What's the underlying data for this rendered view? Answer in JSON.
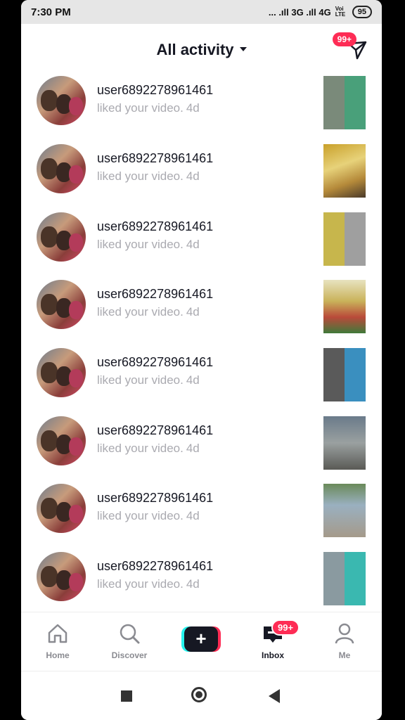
{
  "status": {
    "time": "7:30 PM",
    "network": "... .ıll 3G .ıll 4G",
    "lte": "Voi LTE",
    "battery": "95"
  },
  "header": {
    "title": "All activity",
    "messages_badge": "99+"
  },
  "activities": [
    {
      "user": "user6892278961461",
      "text": "liked your video.",
      "time": "4d"
    },
    {
      "user": "user6892278961461",
      "text": "liked your video.",
      "time": "4d"
    },
    {
      "user": "user6892278961461",
      "text": "liked your video.",
      "time": "4d"
    },
    {
      "user": "user6892278961461",
      "text": "liked your video.",
      "time": "4d"
    },
    {
      "user": "user6892278961461",
      "text": "liked your video.",
      "time": "4d"
    },
    {
      "user": "user6892278961461",
      "text": "liked your video.",
      "time": "4d"
    },
    {
      "user": "user6892278961461",
      "text": "liked your video.",
      "time": "4d"
    },
    {
      "user": "user6892278961461",
      "text": "liked your video.",
      "time": "4d"
    }
  ],
  "nav": {
    "home": "Home",
    "discover": "Discover",
    "inbox": "Inbox",
    "inbox_badge": "99+",
    "me": "Me"
  },
  "colors": {
    "accent": "#fe2c55",
    "accent2": "#25f4ee",
    "text": "#161823",
    "muted": "#aaaab0"
  },
  "icons": [
    "home-icon",
    "search-icon",
    "create-plus-icon",
    "inbox-icon",
    "profile-icon",
    "direct-message-icon",
    "caret-down-icon"
  ]
}
